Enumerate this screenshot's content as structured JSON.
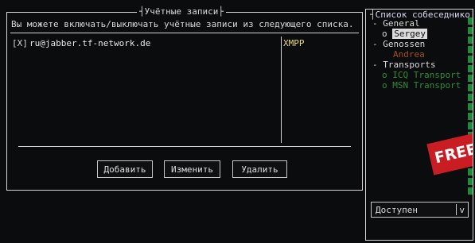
{
  "accounts_window": {
    "title": "Учётные записи",
    "description": "Вы можете включать/выключать учётные записи из следующего списка.",
    "rows": [
      {
        "checkbox": "[X]",
        "jid": "ru@jabber.tf-network.de",
        "protocol": "XMPP"
      }
    ],
    "buttons": {
      "add": "Добавить",
      "edit": "Изменить",
      "delete": "Удалить"
    }
  },
  "roster": {
    "title": "Список собеседнико",
    "groups": [
      {
        "prefix": "-",
        "name": "General",
        "contacts": [
          {
            "marker": "o",
            "name": "Sergey",
            "status": "online"
          }
        ]
      },
      {
        "prefix": "-",
        "name": "Genossen",
        "contacts": [
          {
            "marker": "",
            "name": "Andrea",
            "status": "away"
          }
        ]
      },
      {
        "prefix": "-",
        "name": "Transports",
        "contacts": [
          {
            "marker": "o",
            "name": "ICQ Transport",
            "status": "offline"
          },
          {
            "marker": "o",
            "name": "MSN Transport",
            "status": "offline"
          }
        ]
      }
    ],
    "status_select": {
      "value": "Доступен",
      "arrow": "v"
    }
  },
  "overlay_banner": {
    "text": "FREE"
  },
  "colors": {
    "background": "#0b0c0d",
    "border": "#d6d6d6",
    "offline": "#2f8a3a",
    "protocol": "#e8d87a",
    "away": "#c9602a",
    "banner": "#c91d23"
  }
}
